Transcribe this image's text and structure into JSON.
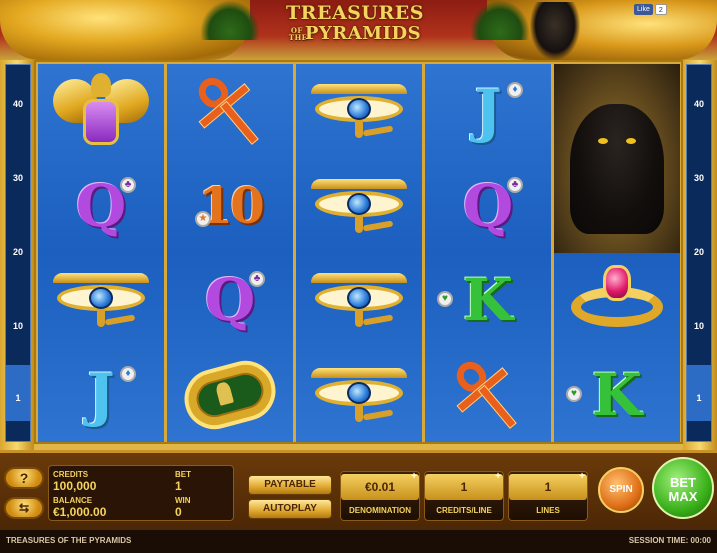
{
  "header": {
    "title_line1": "TREASURES",
    "title_of_the": "OF THE",
    "title_line2": "PYRAMIDS",
    "like_label": "Like",
    "like_count": "2"
  },
  "paylines_left": [
    "40",
    "30",
    "20",
    "10",
    "1"
  ],
  "paylines_right": [
    "40",
    "30",
    "20",
    "10",
    "1"
  ],
  "reels": [
    [
      {
        "symbol": "scarab-icon"
      },
      {
        "symbol": "Q",
        "suit": "♣"
      },
      {
        "symbol": "eye-icon"
      },
      {
        "symbol": "J",
        "suit": "♦"
      }
    ],
    [
      {
        "symbol": "ankh-icon"
      },
      {
        "symbol": "10",
        "suit": "★"
      },
      {
        "symbol": "Q",
        "suit": "♣"
      },
      {
        "symbol": "cartouche-icon"
      }
    ],
    [
      {
        "symbol": "eye-icon"
      },
      {
        "symbol": "eye-icon"
      },
      {
        "symbol": "eye-icon"
      },
      {
        "symbol": "eye-icon"
      }
    ],
    [
      {
        "symbol": "J",
        "suit": "♦"
      },
      {
        "symbol": "Q",
        "suit": "♣"
      },
      {
        "symbol": "K",
        "suit": "♥"
      },
      {
        "symbol": "ankh-icon"
      }
    ],
    [
      {
        "symbol": "panther-icon"
      },
      {
        "symbol": "ring-icon"
      },
      {
        "symbol": "K",
        "suit": "♥"
      }
    ]
  ],
  "info": {
    "credits_label": "CREDITS",
    "credits_value": "100,000",
    "bet_label": "BET",
    "bet_value": "1",
    "balance_label": "BALANCE",
    "balance_value": "€1,000.00",
    "win_label": "WIN",
    "win_value": "0"
  },
  "controls": {
    "help_label": "?",
    "settings_label": "⇆",
    "paytable_label": "PAYTABLE",
    "autoplay_label": "AUTOPLAY",
    "denomination_value": "€0.01",
    "denomination_label": "DENOMINATION",
    "credits_line_value": "1",
    "credits_line_label": "CREDITS/LINE",
    "lines_value": "1",
    "lines_label": "LINES",
    "spin_label": "SPIN",
    "betmax_label_1": "BET",
    "betmax_label_2": "MAX"
  },
  "status": {
    "game_name": "TREASURES OF THE PYRAMIDS",
    "session_time": "SESSION TIME: 00:00"
  },
  "colors": {
    "reel_blue": "#1c5fbf",
    "gold": "#f4d35e",
    "panel_brown": "#4a2605"
  }
}
